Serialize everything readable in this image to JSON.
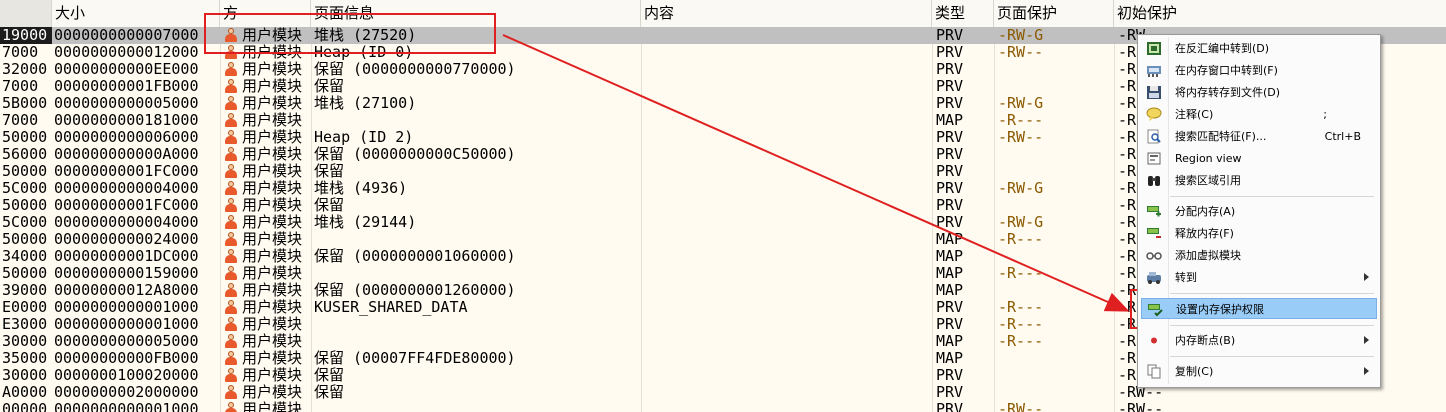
{
  "header": {
    "addr": "",
    "size": "大小",
    "owner": "方",
    "info": "页面信息",
    "content": "内容",
    "type": "类型",
    "protect": "页面保护",
    "init_protect": "初始保护"
  },
  "rows": [
    {
      "addr": "19000",
      "size": "0000000000007000",
      "owner": "用户模块",
      "info": "堆栈 (27520)",
      "type": "PRV",
      "prot": "-RW-G",
      "init": "-RW--"
    },
    {
      "addr": "7000",
      "size": "0000000000012000",
      "owner": "用户模块",
      "info": "Heap (ID 0)",
      "type": "PRV",
      "prot": "-RW--",
      "init": "-R"
    },
    {
      "addr": "32000",
      "size": "00000000000EE000",
      "owner": "用户模块",
      "info": "保留 (0000000000770000)",
      "type": "PRV",
      "prot": "",
      "init": "-R"
    },
    {
      "addr": "7000",
      "size": "00000000001FB000",
      "owner": "用户模块",
      "info": "保留",
      "type": "PRV",
      "prot": "",
      "init": "-R"
    },
    {
      "addr": "5B000",
      "size": "0000000000005000",
      "owner": "用户模块",
      "info": "堆栈 (27100)",
      "type": "PRV",
      "prot": "-RW-G",
      "init": "-R"
    },
    {
      "addr": "7000",
      "size": "0000000000181000",
      "owner": "用户模块",
      "info": "",
      "type": "MAP",
      "prot": "-R---",
      "init": "-R"
    },
    {
      "addr": "50000",
      "size": "0000000000006000",
      "owner": "用户模块",
      "info": "Heap (ID 2)",
      "type": "PRV",
      "prot": "-RW--",
      "init": "-R"
    },
    {
      "addr": "56000",
      "size": "000000000000A000",
      "owner": "用户模块",
      "info": "保留 (0000000000C50000)",
      "type": "PRV",
      "prot": "",
      "init": "-R"
    },
    {
      "addr": "50000",
      "size": "00000000001FC000",
      "owner": "用户模块",
      "info": "保留",
      "type": "PRV",
      "prot": "",
      "init": "-R"
    },
    {
      "addr": "5C000",
      "size": "0000000000004000",
      "owner": "用户模块",
      "info": "堆栈 (4936)",
      "type": "PRV",
      "prot": "-RW-G",
      "init": "-R"
    },
    {
      "addr": "50000",
      "size": "00000000001FC000",
      "owner": "用户模块",
      "info": "保留",
      "type": "PRV",
      "prot": "",
      "init": "-R"
    },
    {
      "addr": "5C000",
      "size": "0000000000004000",
      "owner": "用户模块",
      "info": "堆栈 (29144)",
      "type": "PRV",
      "prot": "-RW-G",
      "init": "-R"
    },
    {
      "addr": "50000",
      "size": "0000000000024000",
      "owner": "用户模块",
      "info": "",
      "type": "MAP",
      "prot": "-R---",
      "init": "-R"
    },
    {
      "addr": "34000",
      "size": "00000000001DC000",
      "owner": "用户模块",
      "info": "保留 (0000000001060000)",
      "type": "MAP",
      "prot": "",
      "init": "-R"
    },
    {
      "addr": "50000",
      "size": "0000000000159000",
      "owner": "用户模块",
      "info": "",
      "type": "MAP",
      "prot": "-R---",
      "init": "-R"
    },
    {
      "addr": "39000",
      "size": "00000000012A8000",
      "owner": "用户模块",
      "info": "保留 (0000000001260000)",
      "type": "MAP",
      "prot": "",
      "init": "-R"
    },
    {
      "addr": "E0000",
      "size": "0000000000001000",
      "owner": "用户模块",
      "info": "KUSER_SHARED_DATA",
      "type": "PRV",
      "prot": "-R---",
      "init": "-R"
    },
    {
      "addr": "E3000",
      "size": "0000000000001000",
      "owner": "用户模块",
      "info": "",
      "type": "PRV",
      "prot": "-R---",
      "init": "-R"
    },
    {
      "addr": "30000",
      "size": "0000000000005000",
      "owner": "用户模块",
      "info": "",
      "type": "MAP",
      "prot": "-R---",
      "init": "-R"
    },
    {
      "addr": "35000",
      "size": "00000000000FB000",
      "owner": "用户模块",
      "info": "保留 (00007FF4FDE80000)",
      "type": "MAP",
      "prot": "",
      "init": "-R"
    },
    {
      "addr": "30000",
      "size": "0000000100020000",
      "owner": "用户模块",
      "info": "保留",
      "type": "PRV",
      "prot": "",
      "init": "-R"
    },
    {
      "addr": "A0000",
      "size": "0000000002000000",
      "owner": "用户模块",
      "info": "保留",
      "type": "PRV",
      "prot": "",
      "init": "-RW--"
    },
    {
      "addr": "00000",
      "size": "0000000000001000",
      "owner": "用户模块",
      "info": "",
      "type": "PRV",
      "prot": "-RW--",
      "init": "-RW--"
    }
  ],
  "menu": {
    "items": [
      {
        "label": "在反汇编中转到(D)",
        "shortcut": "",
        "icon": "disassembly-icon"
      },
      {
        "label": "在内存窗口中转到(F)",
        "shortcut": "",
        "icon": "memory-window-icon"
      },
      {
        "label": "将内存转存到文件(D)",
        "shortcut": "",
        "icon": "floppy-disk-icon"
      },
      {
        "label": "注释(C)",
        "shortcut": ";",
        "icon": "comment-icon"
      },
      {
        "label": "搜索匹配特征(F)...",
        "shortcut": "Ctrl+B",
        "icon": "search-pattern-icon"
      },
      {
        "label": "Region view",
        "shortcut": "",
        "icon": "region-view-icon"
      },
      {
        "label": "搜索区域引用",
        "shortcut": "",
        "icon": "binoculars-icon"
      },
      {
        "label": "分配内存(A)",
        "shortcut": "",
        "icon": "allocate-memory-icon"
      },
      {
        "label": "释放内存(F)",
        "shortcut": "",
        "icon": "free-memory-icon"
      },
      {
        "label": "添加虚拟模块",
        "shortcut": "",
        "icon": "glasses-icon"
      },
      {
        "label": "转到",
        "shortcut": "",
        "icon": "goto-icon"
      },
      {
        "label": "设置内存保护权限",
        "shortcut": "",
        "icon": "set-protection-icon"
      },
      {
        "label": "内存断点(B)",
        "shortcut": "",
        "icon": "breakpoint-dot-icon"
      },
      {
        "label": "复制(C)",
        "shortcut": "",
        "icon": "copy-icon"
      }
    ]
  },
  "colors": {
    "row_bg": "#fffbf0",
    "selected_row": "#c0c0c0",
    "annotation_red": "#e02020",
    "menu_highlight": "#99ccf7",
    "protect_text": "#8b5a00"
  }
}
